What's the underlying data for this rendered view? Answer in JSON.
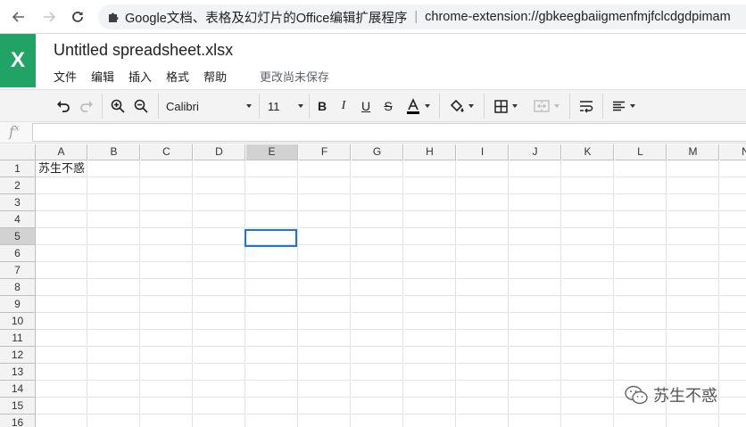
{
  "browser": {
    "extension_title": "Google文档、表格及幻灯片的Office编辑扩展程序",
    "url": "chrome-extension://gbkeegbaiigmenfmjfclcdgdpimam"
  },
  "app": {
    "logo_letter": "X",
    "doc_title": "Untitled spreadsheet.xlsx",
    "menus": [
      "文件",
      "编辑",
      "插入",
      "格式",
      "帮助"
    ],
    "save_status": "更改尚未保存"
  },
  "toolbar": {
    "font_family": "Calibri",
    "font_size": "11"
  },
  "formula_bar": {
    "fx_label": "f",
    "fx_sup": "x",
    "value": ""
  },
  "sheet": {
    "columns": [
      "A",
      "B",
      "C",
      "D",
      "E",
      "F",
      "G",
      "H",
      "I",
      "J",
      "K",
      "L",
      "M",
      "N"
    ],
    "rows": [
      "1",
      "2",
      "3",
      "4",
      "5",
      "6",
      "7",
      "8",
      "9",
      "10",
      "11",
      "12",
      "13",
      "14",
      "15",
      "16"
    ],
    "selected_column": "E",
    "selected_row": "5",
    "active_cell": "E5",
    "cells": {
      "A1": "苏生不惑"
    }
  },
  "watermark": {
    "text": "苏生不惑"
  },
  "colors": {
    "brand": "#21a366",
    "selection": "#1a73e8"
  }
}
